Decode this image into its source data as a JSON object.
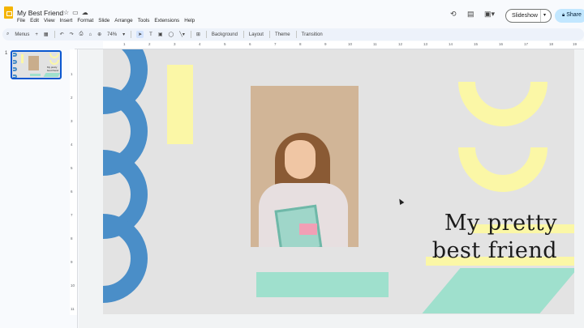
{
  "app": {
    "doc_title": "My Best Friend",
    "menu": [
      "File",
      "Edit",
      "View",
      "Insert",
      "Format",
      "Slide",
      "Arrange",
      "Tools",
      "Extensions",
      "Help"
    ],
    "slideshow_label": "Slideshow",
    "share_label": "Share"
  },
  "toolbar": {
    "menus_label": "Menus",
    "zoom": "74%",
    "background_label": "Background",
    "layout_label": "Layout",
    "theme_label": "Theme",
    "transition_label": "Transition"
  },
  "filmstrip": {
    "slide_number": "1",
    "thumb_text_line1": "My pretty",
    "thumb_text_line2": "best friend"
  },
  "ruler": {
    "horizontal": [
      "1",
      "2",
      "3",
      "4",
      "5",
      "6",
      "7",
      "8",
      "9",
      "10",
      "11",
      "12",
      "13",
      "14",
      "15",
      "16",
      "17",
      "18",
      "19"
    ],
    "vertical": [
      "1",
      "2",
      "3",
      "4",
      "5",
      "6",
      "7",
      "8",
      "9",
      "10",
      "11"
    ]
  },
  "slide": {
    "headline_line1": "My pretty",
    "headline_line2": "best friend"
  }
}
